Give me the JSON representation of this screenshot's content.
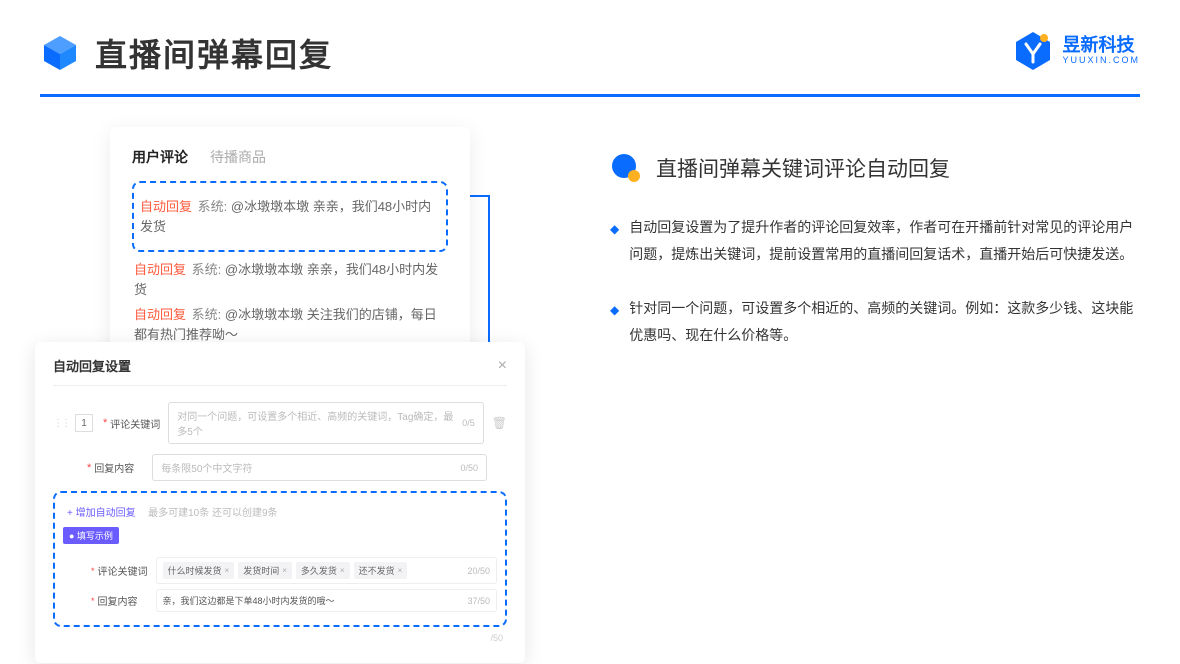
{
  "header": {
    "title": "直播间弹幕回复",
    "brand_name": "昱新科技",
    "brand_sub": "YUUXIN.COM"
  },
  "card1": {
    "tab_active": "用户评论",
    "tab_inactive": "待播商品",
    "auto_reply_label": "自动回复",
    "system_label": "系统:",
    "msg1": "@冰墩墩本墩 亲亲，我们48小时内发货",
    "msg2": "@冰墩墩本墩 亲亲，我们48小时内发货",
    "msg3": "@冰墩墩本墩 关注我们的店铺，每日都有热门推荐呦～"
  },
  "modal": {
    "title": "自动回复设置",
    "row_num": "1",
    "label_keywords": "评论关键词",
    "placeholder_keywords": "对同一个问题，可设置多个相近、高频的关键词，Tag确定，最多5个",
    "counter_keywords": "0/5",
    "label_content": "回复内容",
    "placeholder_content": "每条限50个中文字符",
    "counter_content": "0/50",
    "add_link": "+ 增加自动回复",
    "add_hint": "最多可建10条 还可以创建9条",
    "example_tag": "● 填写示例",
    "ex_label_kw": "评论关键词",
    "ex_tags": [
      "什么时候发货",
      "发货时间",
      "多久发货",
      "还不发货"
    ],
    "ex_kw_counter": "20/50",
    "ex_label_ct": "回复内容",
    "ex_content": "亲，我们这边都是下单48小时内发货的哦～",
    "ex_ct_counter": "37/50",
    "outer_counter": "/50"
  },
  "right": {
    "section_title": "直播间弹幕关键词评论自动回复",
    "bullet1": "自动回复设置为了提升作者的评论回复效率，作者可在开播前针对常见的评论用户问题，提炼出关键词，提前设置常用的直播间回复话术，直播开始后可快捷发送。",
    "bullet2": "针对同一个问题，可设置多个相近的、高频的关键词。例如：这款多少钱、这块能优惠吗、现在什么价格等。"
  }
}
